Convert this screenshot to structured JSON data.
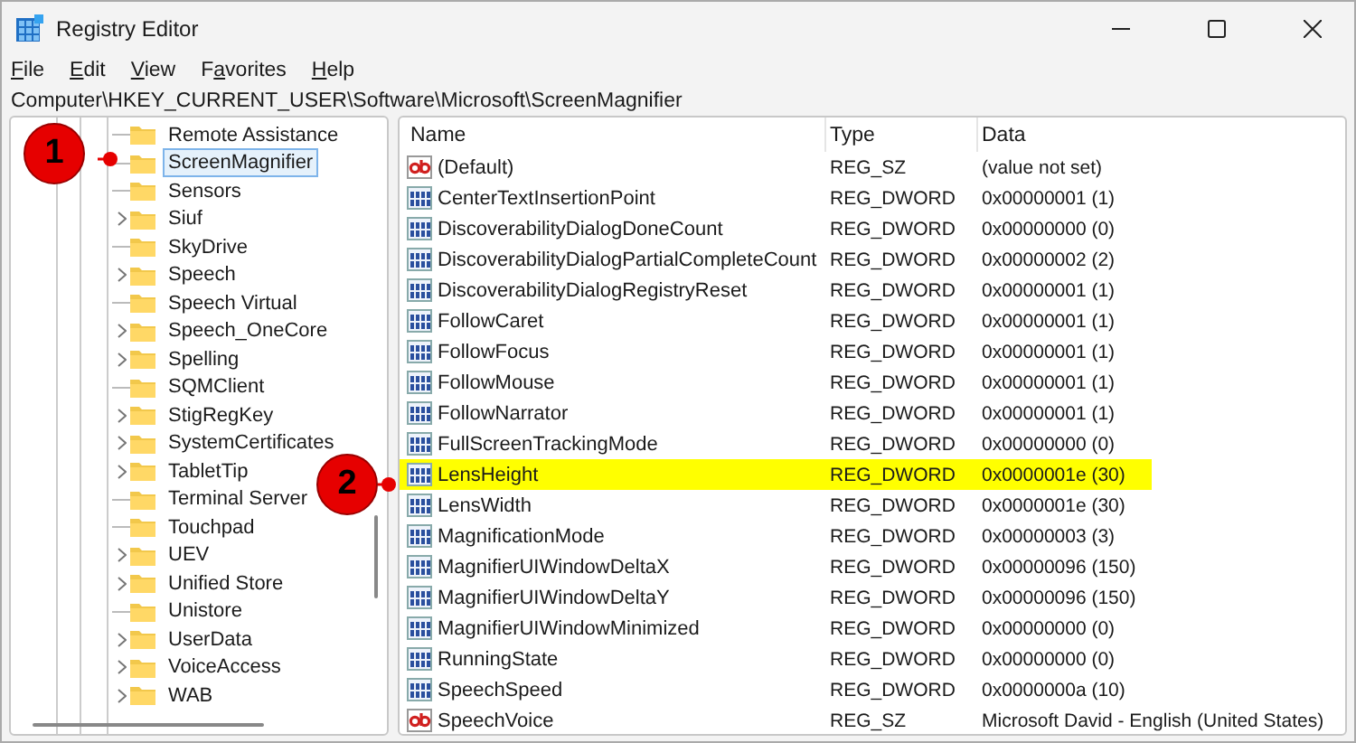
{
  "window": {
    "title": "Registry Editor"
  },
  "menu": [
    "File",
    "Edit",
    "View",
    "Favorites",
    "Help"
  ],
  "address": "Computer\\HKEY_CURRENT_USER\\Software\\Microsoft\\ScreenMagnifier",
  "tree": [
    {
      "label": "Remote Assistance",
      "expandable": false,
      "selected": false
    },
    {
      "label": "ScreenMagnifier",
      "expandable": false,
      "selected": true
    },
    {
      "label": "Sensors",
      "expandable": false,
      "selected": false
    },
    {
      "label": "Siuf",
      "expandable": true,
      "selected": false
    },
    {
      "label": "SkyDrive",
      "expandable": false,
      "selected": false
    },
    {
      "label": "Speech",
      "expandable": true,
      "selected": false
    },
    {
      "label": "Speech Virtual",
      "expandable": false,
      "selected": false
    },
    {
      "label": "Speech_OneCore",
      "expandable": true,
      "selected": false
    },
    {
      "label": "Spelling",
      "expandable": true,
      "selected": false
    },
    {
      "label": "SQMClient",
      "expandable": false,
      "selected": false
    },
    {
      "label": "StigRegKey",
      "expandable": true,
      "selected": false
    },
    {
      "label": "SystemCertificates",
      "expandable": true,
      "selected": false
    },
    {
      "label": "TabletTip",
      "expandable": true,
      "selected": false
    },
    {
      "label": "Terminal Server",
      "expandable": false,
      "selected": false
    },
    {
      "label": "Touchpad",
      "expandable": false,
      "selected": false
    },
    {
      "label": "UEV",
      "expandable": true,
      "selected": false
    },
    {
      "label": "Unified Store",
      "expandable": true,
      "selected": false
    },
    {
      "label": "Unistore",
      "expandable": false,
      "selected": false
    },
    {
      "label": "UserData",
      "expandable": true,
      "selected": false
    },
    {
      "label": "VoiceAccess",
      "expandable": true,
      "selected": false
    },
    {
      "label": "WAB",
      "expandable": true,
      "selected": false
    }
  ],
  "table": {
    "columns": [
      "Name",
      "Type",
      "Data"
    ],
    "rows": [
      {
        "kind": "string",
        "name": "(Default)",
        "type": "REG_SZ",
        "data": "(value not set)",
        "highlighted": false
      },
      {
        "kind": "dword",
        "name": "CenterTextInsertionPoint",
        "type": "REG_DWORD",
        "data": "0x00000001 (1)",
        "highlighted": false
      },
      {
        "kind": "dword",
        "name": "DiscoverabilityDialogDoneCount",
        "type": "REG_DWORD",
        "data": "0x00000000 (0)",
        "highlighted": false
      },
      {
        "kind": "dword",
        "name": "DiscoverabilityDialogPartialCompleteCount",
        "type": "REG_DWORD",
        "data": "0x00000002 (2)",
        "highlighted": false
      },
      {
        "kind": "dword",
        "name": "DiscoverabilityDialogRegistryReset",
        "type": "REG_DWORD",
        "data": "0x00000001 (1)",
        "highlighted": false
      },
      {
        "kind": "dword",
        "name": "FollowCaret",
        "type": "REG_DWORD",
        "data": "0x00000001 (1)",
        "highlighted": false
      },
      {
        "kind": "dword",
        "name": "FollowFocus",
        "type": "REG_DWORD",
        "data": "0x00000001 (1)",
        "highlighted": false
      },
      {
        "kind": "dword",
        "name": "FollowMouse",
        "type": "REG_DWORD",
        "data": "0x00000001 (1)",
        "highlighted": false
      },
      {
        "kind": "dword",
        "name": "FollowNarrator",
        "type": "REG_DWORD",
        "data": "0x00000001 (1)",
        "highlighted": false
      },
      {
        "kind": "dword",
        "name": "FullScreenTrackingMode",
        "type": "REG_DWORD",
        "data": "0x00000000 (0)",
        "highlighted": false
      },
      {
        "kind": "dword",
        "name": "LensHeight",
        "type": "REG_DWORD",
        "data": "0x0000001e (30)",
        "highlighted": true
      },
      {
        "kind": "dword",
        "name": "LensWidth",
        "type": "REG_DWORD",
        "data": "0x0000001e (30)",
        "highlighted": false
      },
      {
        "kind": "dword",
        "name": "MagnificationMode",
        "type": "REG_DWORD",
        "data": "0x00000003 (3)",
        "highlighted": false
      },
      {
        "kind": "dword",
        "name": "MagnifierUIWindowDeltaX",
        "type": "REG_DWORD",
        "data": "0x00000096 (150)",
        "highlighted": false
      },
      {
        "kind": "dword",
        "name": "MagnifierUIWindowDeltaY",
        "type": "REG_DWORD",
        "data": "0x00000096 (150)",
        "highlighted": false
      },
      {
        "kind": "dword",
        "name": "MagnifierUIWindowMinimized",
        "type": "REG_DWORD",
        "data": "0x00000000 (0)",
        "highlighted": false
      },
      {
        "kind": "dword",
        "name": "RunningState",
        "type": "REG_DWORD",
        "data": "0x00000000 (0)",
        "highlighted": false
      },
      {
        "kind": "dword",
        "name": "SpeechSpeed",
        "type": "REG_DWORD",
        "data": "0x0000000a (10)",
        "highlighted": false
      },
      {
        "kind": "string",
        "name": "SpeechVoice",
        "type": "REG_SZ",
        "data": "Microsoft David - English (United States)",
        "highlighted": false
      }
    ]
  },
  "callouts": [
    "1",
    "2"
  ]
}
